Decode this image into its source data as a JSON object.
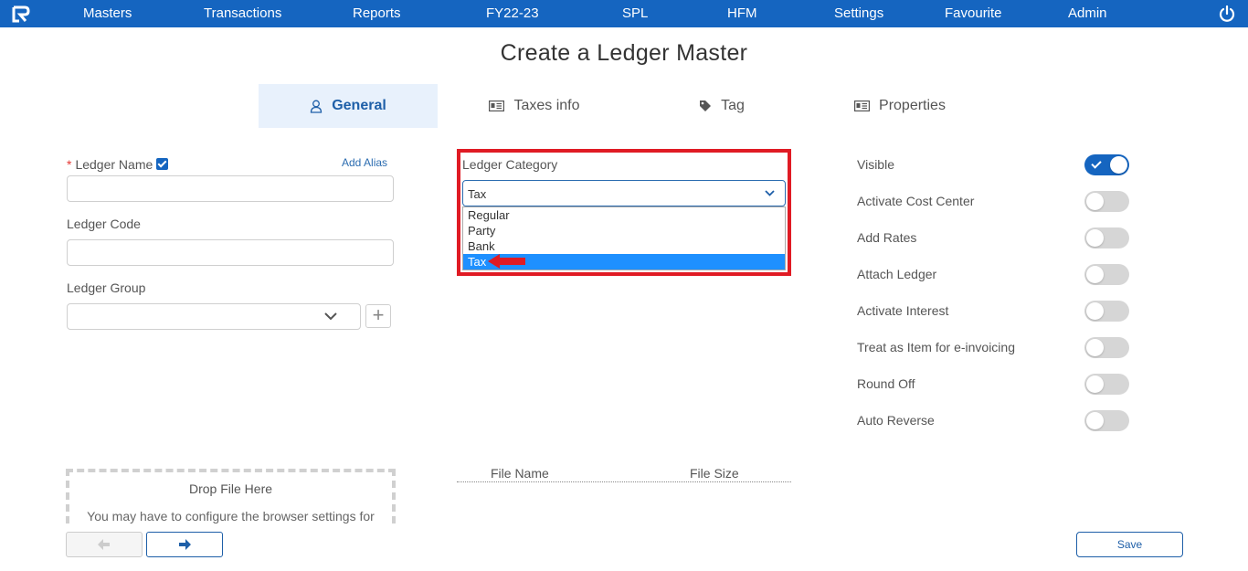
{
  "nav": {
    "items": [
      "Masters",
      "Transactions",
      "Reports",
      "FY22-23",
      "SPL",
      "HFM",
      "Settings",
      "Favourite",
      "Admin"
    ]
  },
  "page": {
    "title": "Create a Ledger Master"
  },
  "tabs": [
    {
      "label": "General",
      "icon": "user-icon",
      "active": true
    },
    {
      "label": "Taxes info",
      "icon": "id-card-icon",
      "active": false
    },
    {
      "label": "Tag",
      "icon": "tag-icon",
      "active": false
    },
    {
      "label": "Properties",
      "icon": "id-card-icon",
      "active": false
    }
  ],
  "form": {
    "ledger_name_label": "Ledger Name",
    "ledger_name_value": "",
    "add_alias": "Add Alias",
    "ledger_code_label": "Ledger Code",
    "ledger_code_value": "",
    "ledger_group_label": "Ledger Group",
    "ledger_group_value": ""
  },
  "category": {
    "label": "Ledger Category",
    "selected": "Tax",
    "options": [
      "Regular",
      "Party",
      "Bank",
      "Tax"
    ]
  },
  "toggles": [
    {
      "label": "Visible",
      "on": true
    },
    {
      "label": "Activate Cost Center",
      "on": false
    },
    {
      "label": "Add Rates",
      "on": false
    },
    {
      "label": "Attach Ledger",
      "on": false
    },
    {
      "label": "Activate Interest",
      "on": false
    },
    {
      "label": "Treat as Item for e-invoicing",
      "on": false
    },
    {
      "label": "Round Off",
      "on": false
    },
    {
      "label": "Auto Reverse",
      "on": false
    }
  ],
  "upload": {
    "drop_title": "Drop File Here",
    "drop_subtitle": "You may have to configure the browser settings for",
    "col_file_name": "File Name",
    "col_file_size": "File Size"
  },
  "buttons": {
    "save": "Save"
  },
  "colors": {
    "primary": "#1565c0",
    "highlight": "#e01b24",
    "selected_option": "#1e90ff"
  }
}
